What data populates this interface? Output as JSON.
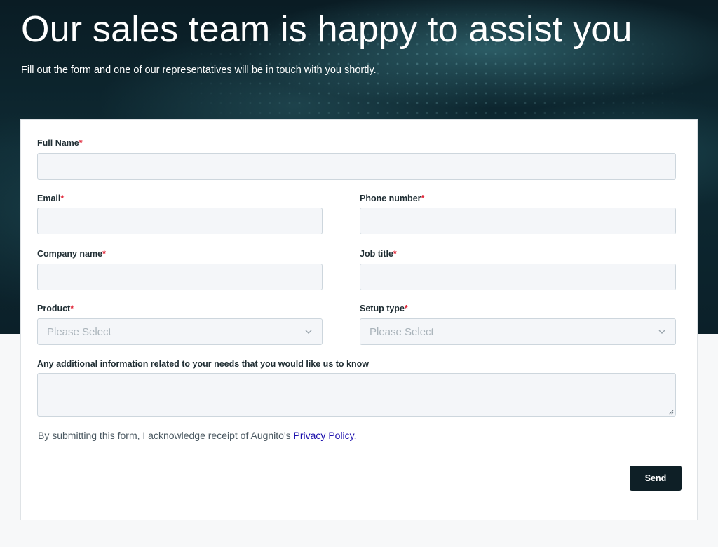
{
  "hero": {
    "title": "Our sales team is happy to assist you",
    "subtitle": "Fill out the form and one of our representatives will be in touch with you shortly."
  },
  "form": {
    "required_marker": "*",
    "full_name": {
      "label": "Full Name",
      "value": ""
    },
    "email": {
      "label": "Email",
      "value": ""
    },
    "phone": {
      "label": "Phone number",
      "value": ""
    },
    "company": {
      "label": "Company name",
      "value": ""
    },
    "job_title": {
      "label": "Job title",
      "value": ""
    },
    "product": {
      "label": "Product",
      "selected": "Please Select"
    },
    "setup_type": {
      "label": "Setup type",
      "selected": "Please Select"
    },
    "additional": {
      "label": "Any additional information related to your needs that you would like us to know",
      "value": ""
    },
    "consent_text": "By submitting this form, I acknowledge receipt of Augnito's",
    "privacy_link": "Privacy Policy.",
    "send_label": "Send"
  },
  "icons": {
    "select_arrow": "chevron-down-icon",
    "resize_handle": "resize-handle-icon"
  },
  "colors": {
    "hero_background": "#0e2a33",
    "required_marker": "#e0283a",
    "field_background": "#f4f6f9",
    "send_button": "#0e1f26",
    "link": "#1a0dab"
  }
}
